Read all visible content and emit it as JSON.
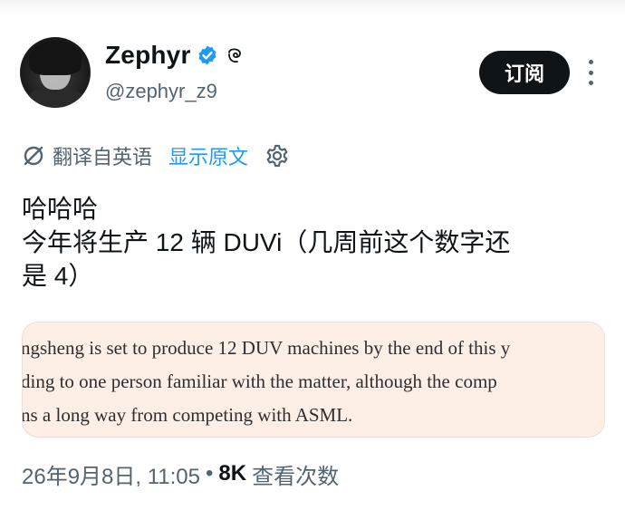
{
  "author": {
    "display_name": "Zephyr",
    "handle": "@zephyr_z9",
    "verified": true
  },
  "actions": {
    "subscribe_label": "订阅"
  },
  "translation": {
    "label": "翻译自英语",
    "show_original": "显示原文"
  },
  "tweet": {
    "lines": [
      "哈哈哈",
      "今年将生产 12 辆 DUVi（几周前这个数字还",
      "是 4）"
    ]
  },
  "media": {
    "lines": [
      "ngsheng is set to produce 12 DUV machines by the end of this y",
      "ding to one person familiar with the matter, although the comp",
      "ns a long way from competing with ASML."
    ]
  },
  "meta": {
    "date": "26年9月8日, 11:05",
    "separator": "•",
    "views_count": "8K",
    "views_label": "查看次数"
  },
  "colors": {
    "accent": "#1d9bf0",
    "text": "#0f1419",
    "secondary": "#536471",
    "media_bg": "#fdeee6"
  },
  "icons": {
    "verified": "verified-badge-icon",
    "extra": "affiliate-badge-icon",
    "translate": "translate-icon",
    "settings": "gear-icon",
    "more": "more-vertical-icon"
  }
}
